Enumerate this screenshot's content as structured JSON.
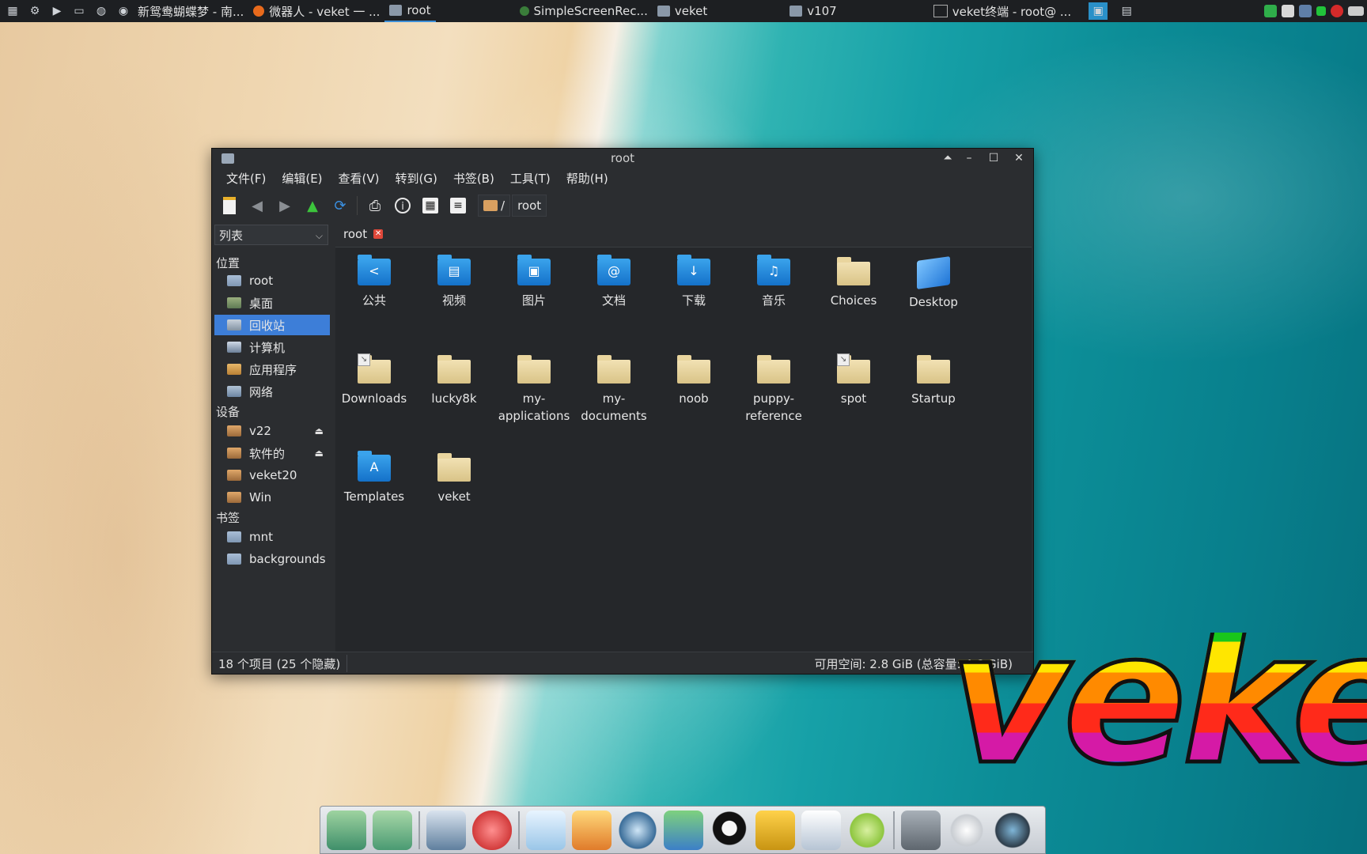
{
  "taskbar": {
    "tasks": [
      {
        "label": "新鸳鸯蝴蝶梦 - 南..."
      },
      {
        "label": "微器人 - veket 一 ..."
      },
      {
        "label": "root"
      },
      {
        "label": "SimpleScreenRec..."
      },
      {
        "label": "veket"
      },
      {
        "label": "v107"
      },
      {
        "label": "veket终端 - root@ ..."
      }
    ]
  },
  "window": {
    "title": "root",
    "menu": [
      "文件(F)",
      "编辑(E)",
      "查看(V)",
      "转到(G)",
      "书签(B)",
      "工具(T)",
      "帮助(H)"
    ],
    "path": {
      "root_crumb": "/",
      "current": "root"
    },
    "view_mode": "列表",
    "tab_label": "root",
    "sidebar": {
      "places_title": "位置",
      "places": [
        "root",
        "桌面",
        "回收站",
        "计算机",
        "应用程序",
        "网络"
      ],
      "devices_title": "设备",
      "devices": [
        "v22",
        "软件的",
        "veket20",
        "Win"
      ],
      "bookmarks_title": "书签",
      "bookmarks": [
        "mnt",
        "backgrounds"
      ]
    },
    "files": [
      {
        "name": "公共",
        "glyph": "<"
      },
      {
        "name": "视频",
        "glyph": "▤"
      },
      {
        "name": "图片",
        "glyph": "▣"
      },
      {
        "name": "文档",
        "glyph": "@"
      },
      {
        "name": "下载",
        "glyph": "↓"
      },
      {
        "name": "音乐",
        "glyph": "♫"
      },
      {
        "name": "Choices"
      },
      {
        "name": "Desktop"
      },
      {
        "name": "Downloads"
      },
      {
        "name": "lucky8k"
      },
      {
        "name": "my-applications"
      },
      {
        "name": "my-documents"
      },
      {
        "name": "noob"
      },
      {
        "name": "puppy-reference"
      },
      {
        "name": "spot"
      },
      {
        "name": "Startup"
      },
      {
        "name": "Templates",
        "glyph": "A"
      },
      {
        "name": "veket"
      }
    ],
    "status": {
      "left": "18 个项目 (25 个隐藏)",
      "right": "可用空间: 2.8 GiB (总容量: 4.6 GiB)"
    }
  },
  "logo_text": "veket",
  "colors": {
    "selection": "#3d7ed8",
    "folder_blue": "#1f86d8"
  }
}
